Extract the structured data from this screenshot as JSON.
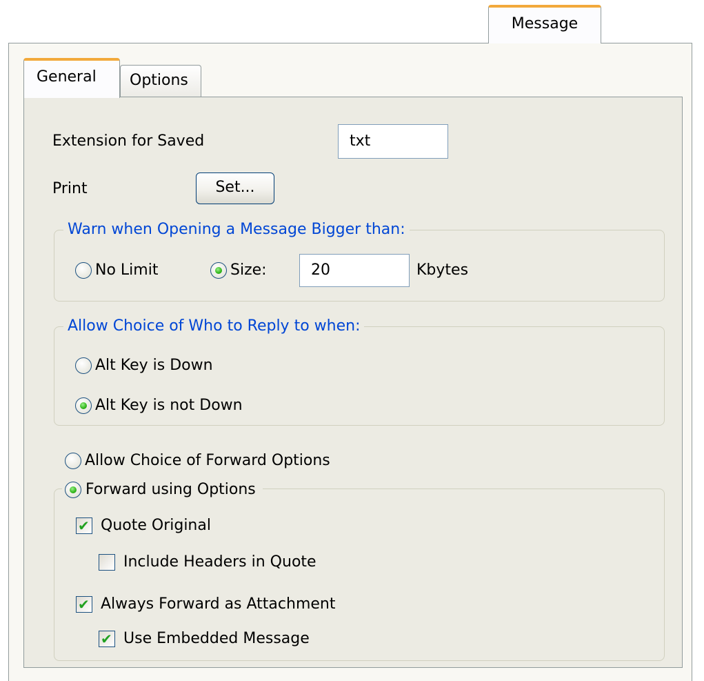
{
  "outer_tab": {
    "label": "Message"
  },
  "tabs": {
    "general": "General",
    "options": "Options"
  },
  "extension": {
    "label": "Extension for Saved",
    "value": "txt"
  },
  "print": {
    "label": "Print",
    "button": "Set..."
  },
  "warn_group": {
    "legend": "Warn when Opening a Message Bigger than:",
    "no_limit": "No Limit",
    "size": "Size:",
    "size_value": "20",
    "unit": "Kbytes",
    "selected": "size"
  },
  "reply_group": {
    "legend": "Allow Choice of Who to Reply to when:",
    "option1": "Alt Key is Down",
    "option2": "Alt Key is not Down",
    "selected": "option2"
  },
  "forward": {
    "allow_choice": "Allow Choice of Forward Options",
    "using_options": "Forward using Options",
    "selected": "using_options",
    "quote_original": {
      "label": "Quote Original",
      "checked": true
    },
    "include_headers": {
      "label": "Include Headers in Quote",
      "checked": false
    },
    "always_attachment": {
      "label": "Always Forward as Attachment",
      "checked": true
    },
    "use_embedded": {
      "label": "Use Embedded Message",
      "checked": true
    }
  },
  "colors": {
    "accent_tab": "#f2a93b",
    "group_legend": "#0046d5",
    "panel": "#ecebe3"
  }
}
